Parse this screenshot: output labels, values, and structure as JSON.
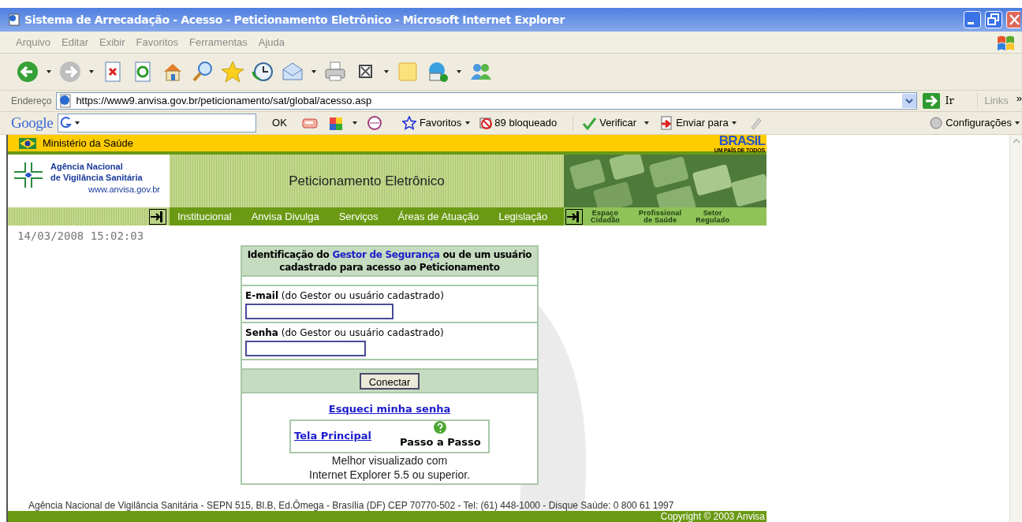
{
  "window": {
    "title": "Sistema de Arrecadação - Acesso - Peticionamento Eletrônico - Microsoft Internet Explorer"
  },
  "menu_bar": [
    "Arquivo",
    "Editar",
    "Exibir",
    "Favoritos",
    "Ferramentas",
    "Ajuda"
  ],
  "address_bar": {
    "label": "Endereço",
    "url": "https://www9.anvisa.gov.br/peticionamento/sat/global/acesso.asp",
    "go": "Ir",
    "links": "Links",
    "more": "»"
  },
  "google_toolbar": {
    "logo": "Google",
    "ok": "OK",
    "favorites": "Favoritos",
    "blocked": "89 bloqueado",
    "check": "Verificar",
    "send": "Enviar para",
    "settings": "Configurações"
  },
  "site_header": {
    "ministry": "Ministério da Saúde",
    "brand": "BRASIL",
    "brand_tagline": "UM PAÍS DE TODOS",
    "agency_lines": [
      "Agência Nacional",
      "de Vigilância Sanitária"
    ],
    "agency_url": "www.anvisa.gov.br",
    "banner_title": "Peticionamento Eletrônico"
  },
  "nav": [
    "Institucional",
    "Anvisa Divulga",
    "Serviços",
    "Áreas de Atuação",
    "Legislação"
  ],
  "audience_nav": [
    {
      "lines": [
        "Espaço",
        "Cidadão"
      ]
    },
    {
      "lines": [
        "Profissional",
        "de Saúde"
      ]
    },
    {
      "lines": [
        "Setor",
        "Regulado"
      ]
    }
  ],
  "datetime": "14/03/2008 15:02:03",
  "login": {
    "heading_before": "Identificação do ",
    "heading_link": "Gestor de Segurança",
    "heading_after": " ou de um usuário cadastrado para acesso ao Peticionamento",
    "fields": [
      {
        "label": "E-mail",
        "note": "(do Gestor ou usuário cadastrado)",
        "kind": "text"
      },
      {
        "label": "Senha",
        "note": "(do Gestor ou usuário cadastrado)",
        "kind": "password"
      }
    ],
    "button": "Conectar",
    "forgot": "Esqueci minha senha",
    "home_link": "Tela Principal",
    "help": "Passo a Passo",
    "note_lines": [
      "Melhor visualizado com",
      "Internet Explorer 5.5 ou superior."
    ]
  },
  "footer": {
    "address": "Agência Nacional de Vigilância Sanitária - SEPN 515, Bl.B, Ed.Ômega - Brasília (DF) CEP 70770-502 - Tel: (61) 448-1000 - Disque Saúde: 0 800 61 1997",
    "copyright": "Copyright © 2003 Anvisa"
  }
}
